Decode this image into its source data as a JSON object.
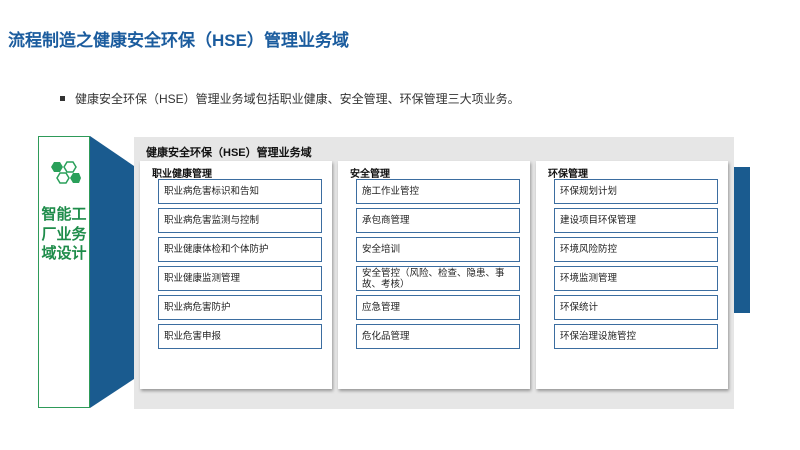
{
  "page_title": "流程制造之健康安全环保（HSE）管理业务域",
  "bullet_text": "健康安全环保（HSE）管理业务域包括职业健康、安全管理、环保管理三大项业务。",
  "side_panel": {
    "vertical_text": "智能工厂业务域设计"
  },
  "main_panel": {
    "title": "健康安全环保（HSE）管理业务域",
    "columns": [
      {
        "title": "职业健康管理",
        "items": [
          "职业病危害标识和告知",
          "职业病危害监测与控制",
          "职业健康体检和个体防护",
          "职业健康监测管理",
          "职业病危害防护",
          "职业危害申报"
        ]
      },
      {
        "title": "安全管理",
        "items": [
          "施工作业管控",
          "承包商管理",
          "安全培训",
          "安全管控（风险、检查、隐患、事故、考核）",
          "应急管理",
          "危化品管理"
        ]
      },
      {
        "title": "环保管理",
        "items": [
          "环保规划计划",
          "建设项目环保管理",
          "环境风险防控",
          "环境监测管理",
          "环保统计",
          "环保治理设施管控"
        ]
      }
    ]
  },
  "colors": {
    "title": "#1b5c9e",
    "accent_blue": "#1a5b8f",
    "green": "#1e8c4a",
    "panel_bg": "#e6e6e6"
  }
}
